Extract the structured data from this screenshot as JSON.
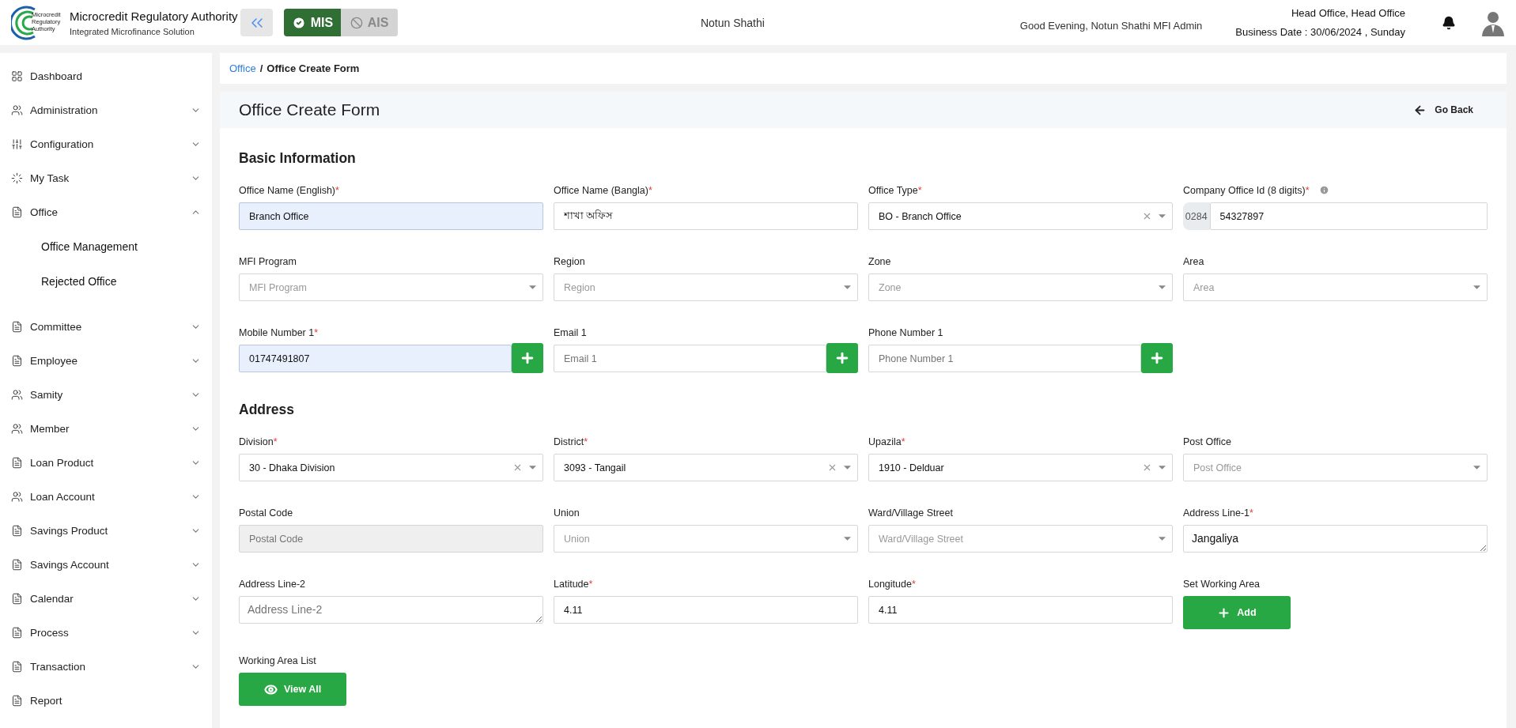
{
  "header": {
    "logo_text": "Microcredit Regulatory Authority",
    "title": "Microcredit Regulatory Authority",
    "subtitle": "Integrated Microfinance Solution",
    "modules": [
      {
        "label": "MIS",
        "selected": true
      },
      {
        "label": "AIS",
        "selected": false
      }
    ],
    "organization": "Notun Shathi",
    "greeting": "Good Evening, Notun Shathi MFI Admin",
    "office": "Head Office, Head Office",
    "business_date": "Business Date : 30/06/2024 , Sunday"
  },
  "sidebar": {
    "items": [
      {
        "label": "Dashboard",
        "kind": "link"
      },
      {
        "label": "Administration",
        "kind": "group",
        "expanded": false
      },
      {
        "label": "Configuration",
        "kind": "group",
        "expanded": false
      },
      {
        "label": "My Task",
        "kind": "group",
        "expanded": false
      },
      {
        "label": "Office",
        "kind": "group",
        "expanded": true,
        "children": [
          {
            "label": "Office Management"
          },
          {
            "label": "Rejected Office"
          }
        ]
      },
      {
        "label": "Committee",
        "kind": "group",
        "expanded": false
      },
      {
        "label": "Employee",
        "kind": "group",
        "expanded": false
      },
      {
        "label": "Samity",
        "kind": "group",
        "expanded": false
      },
      {
        "label": "Member",
        "kind": "group",
        "expanded": false
      },
      {
        "label": "Loan Product",
        "kind": "group",
        "expanded": false
      },
      {
        "label": "Loan Account",
        "kind": "group",
        "expanded": false
      },
      {
        "label": "Savings Product",
        "kind": "group",
        "expanded": false
      },
      {
        "label": "Savings Account",
        "kind": "group",
        "expanded": false
      },
      {
        "label": "Calendar",
        "kind": "group",
        "expanded": false
      },
      {
        "label": "Process",
        "kind": "group",
        "expanded": false
      },
      {
        "label": "Transaction",
        "kind": "group",
        "expanded": false
      },
      {
        "label": "Report",
        "kind": "link"
      }
    ]
  },
  "breadcrumb": {
    "separator": "/",
    "items": [
      {
        "label": "Office",
        "kind": "link"
      },
      {
        "label": "Office Create Form",
        "kind": "current"
      }
    ]
  },
  "page_title": "Office Create Form",
  "back_button": "Go Back",
  "sections": [
    {
      "title": "Basic Information",
      "fields": [
        {
          "label": "Office Name (English)",
          "required_mark": "*",
          "kind": "text",
          "value": "Branch Office",
          "highlighted": true
        },
        {
          "label": "Office Name (Bangla)",
          "required_mark": "*",
          "kind": "text",
          "value": "শাখা অফিস",
          "highlighted": false
        },
        {
          "label": "Office Type",
          "required_mark": "*",
          "kind": "select",
          "value": "BO - Branch Office",
          "clearable": true
        },
        {
          "label": "Company Office Id (8 digits)",
          "required_mark": "*",
          "info": true,
          "kind": "prefixed",
          "prefix": "0284",
          "value": "54327897"
        },
        {
          "label": "MFI Program",
          "kind": "select",
          "placeholder": "MFI Program",
          "clearable": false
        },
        {
          "label": "Region",
          "kind": "select",
          "placeholder": "Region",
          "clearable": false
        },
        {
          "label": "Zone",
          "kind": "select",
          "placeholder": "Zone",
          "clearable": false
        },
        {
          "label": "Area",
          "kind": "select",
          "placeholder": "Area",
          "clearable": false
        },
        {
          "label": "Mobile Number 1",
          "required_mark": "*",
          "kind": "addon",
          "value": "01747491807",
          "highlighted": true
        },
        {
          "label": "Email 1",
          "kind": "addon",
          "placeholder": "Email 1",
          "highlighted": false
        },
        {
          "label": "Phone Number 1",
          "kind": "addon",
          "placeholder": "Phone Number 1",
          "highlighted": false
        }
      ]
    },
    {
      "title": "Address",
      "fields": [
        {
          "label": "Division",
          "required_mark": "*",
          "kind": "select",
          "value": "30 - Dhaka Division",
          "clearable": true
        },
        {
          "label": "District",
          "required_mark": "*",
          "kind": "select",
          "value": "3093 - Tangail",
          "clearable": true
        },
        {
          "label": "Upazila",
          "required_mark": "*",
          "kind": "select",
          "value": "1910 - Delduar",
          "clearable": true
        },
        {
          "label": "Post Office",
          "kind": "select",
          "placeholder": "Post Office",
          "clearable": false
        },
        {
          "label": "Postal Code",
          "kind": "text",
          "placeholder": "Postal Code",
          "disabled": true
        },
        {
          "label": "Union",
          "kind": "select",
          "placeholder": "Union",
          "clearable": false
        },
        {
          "label": "Ward/Village Street",
          "kind": "select",
          "placeholder": "Ward/Village Street",
          "clearable": false
        },
        {
          "label": "Address Line-1",
          "required_mark": "*",
          "kind": "textarea",
          "value": "Jangaliya"
        },
        {
          "label": "Address Line-2",
          "kind": "textarea",
          "placeholder": "Address Line-2"
        },
        {
          "label": "Latitude",
          "required_mark": "*",
          "kind": "text",
          "value": "4.11"
        },
        {
          "label": "Longitude",
          "required_mark": "*",
          "kind": "text",
          "value": "4.11"
        },
        {
          "label": "Set Working Area",
          "kind": "add",
          "button": "Add"
        },
        {
          "label": "Working Area List",
          "kind": "view",
          "button": "View All"
        }
      ]
    }
  ]
}
